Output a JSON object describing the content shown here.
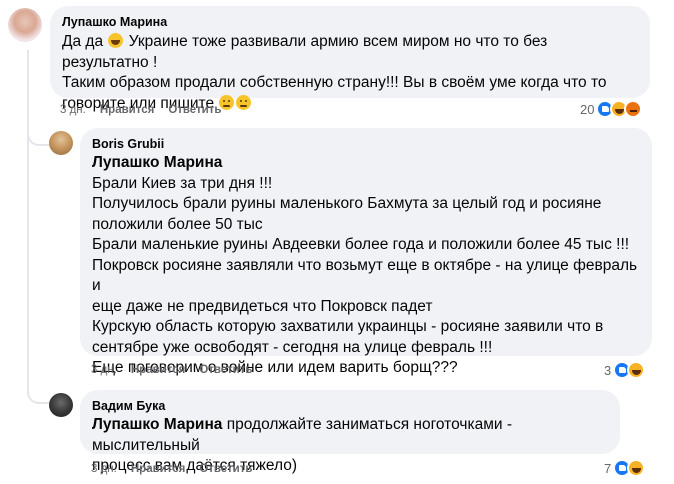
{
  "comments": [
    {
      "author": "Лупашко Марина",
      "lines": [
        {
          "pre": "Да да ",
          "emoji": "laugh",
          "post": " Украине тоже развивали армию всем миром но что то без результатно !"
        },
        {
          "pre": "Таким образом продали собственную страну!!! Вы в своём уме когда что то"
        },
        {
          "pre": "говорите или пишите ",
          "emoji2": "sad"
        }
      ],
      "time": "3 дн.",
      "like": "Нравится",
      "reply": "Ответить",
      "reaction_count": "20",
      "reaction_icons": [
        "like-icon",
        "laugh-icon",
        "angry-icon"
      ]
    },
    {
      "author": "Boris Grubii",
      "mention": "Лупашко Марина",
      "lines": [
        "Брали Киев за три дня !!!",
        "Получилось брали руины маленького Бахмута за целый год и росияне",
        "положили более 50 тыс",
        "Брали маленькие руины Авдеевки более года и положили более 45 тыс !!!",
        "Покровск росияне заявляли что возьмут еще в октябре - на улице февраль и",
        "еще даже не предвидеться что Покровск падет",
        "Курскую область которую захватили украинцы - росияне заявили что в",
        "сентябре уже освободят - сегодня на улице февраль !!!",
        "Еще поговорим о войне или идем варить борщ???"
      ],
      "time": "3 дн.",
      "like": "Нравится",
      "reply": "Ответить",
      "reaction_count": "3",
      "reaction_icons": [
        "like-icon",
        "laugh-icon"
      ]
    },
    {
      "author": "Вадим Бука",
      "mention": "Лупашко Марина",
      "first_line_rest": " продолжайте заниматься ноготочками - мыслительный",
      "lines": [
        "процесс вам даётся тяжело)"
      ],
      "time": "3 дн.",
      "like": "Нравится",
      "reply": "Ответить",
      "reaction_count": "7",
      "reaction_icons": [
        "like-icon",
        "laugh-icon"
      ]
    }
  ]
}
